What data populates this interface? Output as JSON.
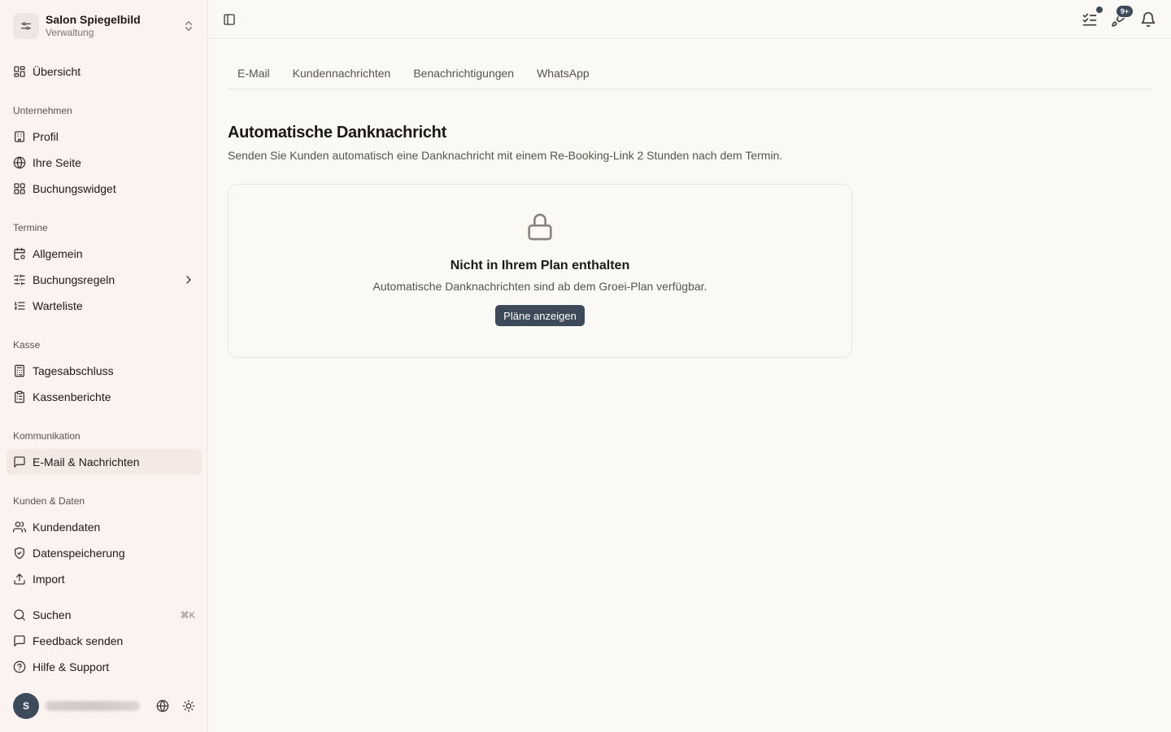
{
  "org": {
    "name": "Salon Spiegelbild",
    "subtitle": "Verwaltung"
  },
  "sidebar": {
    "overview": "Übersicht",
    "sections": {
      "company": "Unternehmen",
      "appointments": "Termine",
      "register": "Kasse",
      "communication": "Kommunikation",
      "customers": "Kunden & Daten"
    },
    "items": {
      "profile": "Profil",
      "your_page": "Ihre Seite",
      "booking_widget": "Buchungswidget",
      "general": "Allgemein",
      "booking_rules": "Buchungsregeln",
      "waitlist": "Warteliste",
      "daily_closing": "Tagesabschluss",
      "register_reports": "Kassenberichte",
      "email_messages": "E-Mail & Nachrichten",
      "customer_data": "Kundendaten",
      "data_storage": "Datenspeicherung",
      "import": "Import"
    },
    "search": "Suchen",
    "search_shortcut": "⌘K",
    "feedback": "Feedback senden",
    "help": "Hilfe & Support"
  },
  "user": {
    "avatar_initial": "S"
  },
  "header": {
    "notification_count": "9+"
  },
  "tabs": [
    "E-Mail",
    "Kundennachrichten",
    "Benachrichtigungen",
    "WhatsApp"
  ],
  "main": {
    "title": "Automatische Danknachricht",
    "description": "Senden Sie Kunden automatisch eine Danknachricht mit einem Re-Booking-Link 2 Stunden nach dem Termin.",
    "locked_card": {
      "title": "Nicht in Ihrem Plan enthalten",
      "text": "Automatische Danknachrichten sind ab dem Groei-Plan verfügbar.",
      "button": "Pläne anzeigen"
    }
  }
}
